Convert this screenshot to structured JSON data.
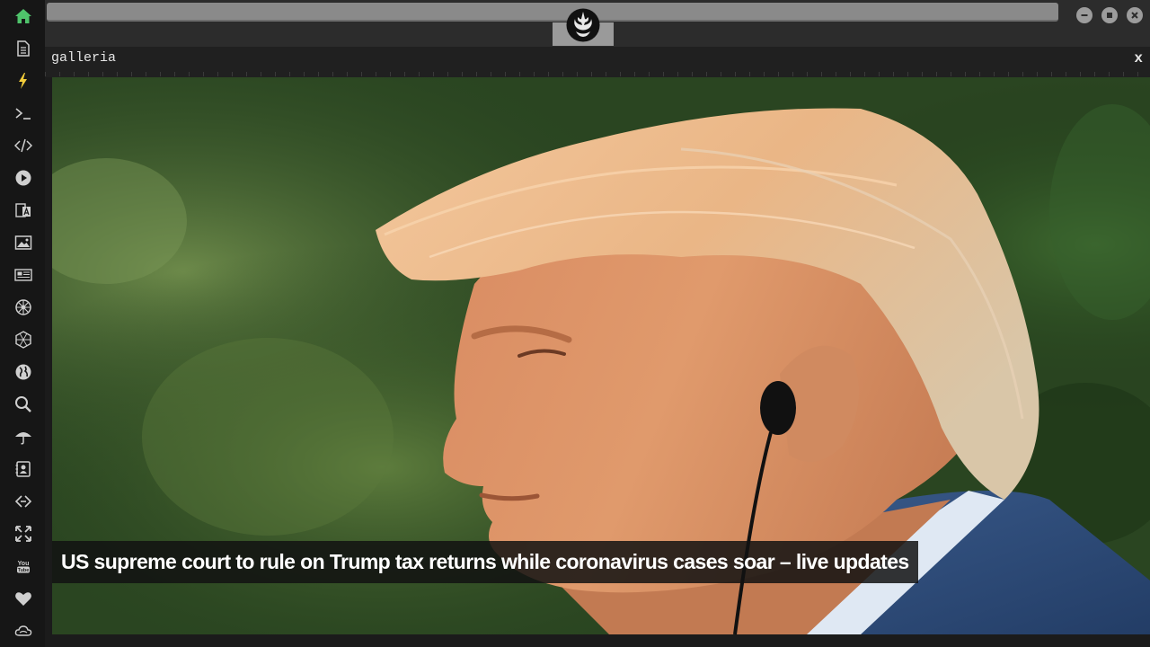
{
  "sidebar": {
    "items": [
      {
        "icon": "home-icon",
        "color": "#4fc36b"
      },
      {
        "icon": "document-icon",
        "color": "#cfcfcf"
      },
      {
        "icon": "lightning-icon",
        "color": "#f2cc3a"
      },
      {
        "icon": "terminal-icon",
        "color": "#cfcfcf"
      },
      {
        "icon": "code-icon",
        "color": "#cfcfcf"
      },
      {
        "icon": "play-icon",
        "color": "#cfcfcf"
      },
      {
        "icon": "translate-icon",
        "color": "#cfcfcf"
      },
      {
        "icon": "image-icon",
        "color": "#cfcfcf"
      },
      {
        "icon": "newspaper-icon",
        "color": "#cfcfcf"
      },
      {
        "icon": "settings-wheel-icon",
        "color": "#cfcfcf"
      },
      {
        "icon": "hexagon-icon",
        "color": "#cfcfcf"
      },
      {
        "icon": "globe-icon",
        "color": "#cfcfcf"
      },
      {
        "icon": "search-icon",
        "color": "#cfcfcf"
      },
      {
        "icon": "umbrella-icon",
        "color": "#cfcfcf"
      },
      {
        "icon": "contacts-icon",
        "color": "#cfcfcf"
      },
      {
        "icon": "link-icon",
        "color": "#cfcfcf"
      },
      {
        "icon": "expand-icon",
        "color": "#cfcfcf"
      },
      {
        "icon": "youtube-icon",
        "color": "#cfcfcf"
      },
      {
        "icon": "heart-icon",
        "color": "#cfcfcf"
      },
      {
        "icon": "cloud-icon",
        "color": "#cfcfcf"
      }
    ]
  },
  "topbar": {
    "url_value": "",
    "logo_icon": "rebel-alliance-icon"
  },
  "window_controls": {
    "minimize_icon": "minimize-icon",
    "maximize_icon": "maximize-icon",
    "close_icon": "close-icon"
  },
  "panel": {
    "title": "galleria",
    "close_label": "x"
  },
  "gallery": {
    "image_description_icon": "photo-image",
    "caption": "US supreme court to rule on Trump tax returns while coronavirus cases soar – live updates"
  },
  "colors": {
    "accent_green": "#4fc36b",
    "accent_yellow": "#f2cc3a",
    "background": "#1b1b1b"
  }
}
